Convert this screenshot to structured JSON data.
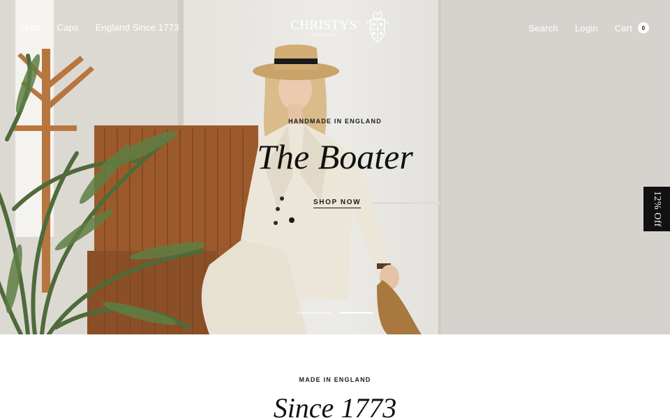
{
  "nav": {
    "left": [
      "Hats",
      "Caps",
      "England Since 1773"
    ],
    "search": "Search",
    "login": "Login",
    "cart": "Cart",
    "cart_count": "0"
  },
  "logo": {
    "wordmark": "CHRISTYS'",
    "sub": "LONDON"
  },
  "hero": {
    "eyebrow": "HANDMADE IN ENGLAND",
    "title": "The Boater",
    "cta": "SHOP NOW",
    "slides": 2,
    "active_slide": 2
  },
  "discount_tab": "12% Off",
  "section": {
    "eyebrow": "MADE IN ENGLAND",
    "title": "Since 1773"
  },
  "colors": {
    "nav_text": "#ffffff",
    "text_dark": "#111111",
    "tab_bg": "#111111",
    "wall": "#e6e3de",
    "wood": "#9c5a2c",
    "plant": "#4f6b3a",
    "linen": "#ece6d8"
  }
}
